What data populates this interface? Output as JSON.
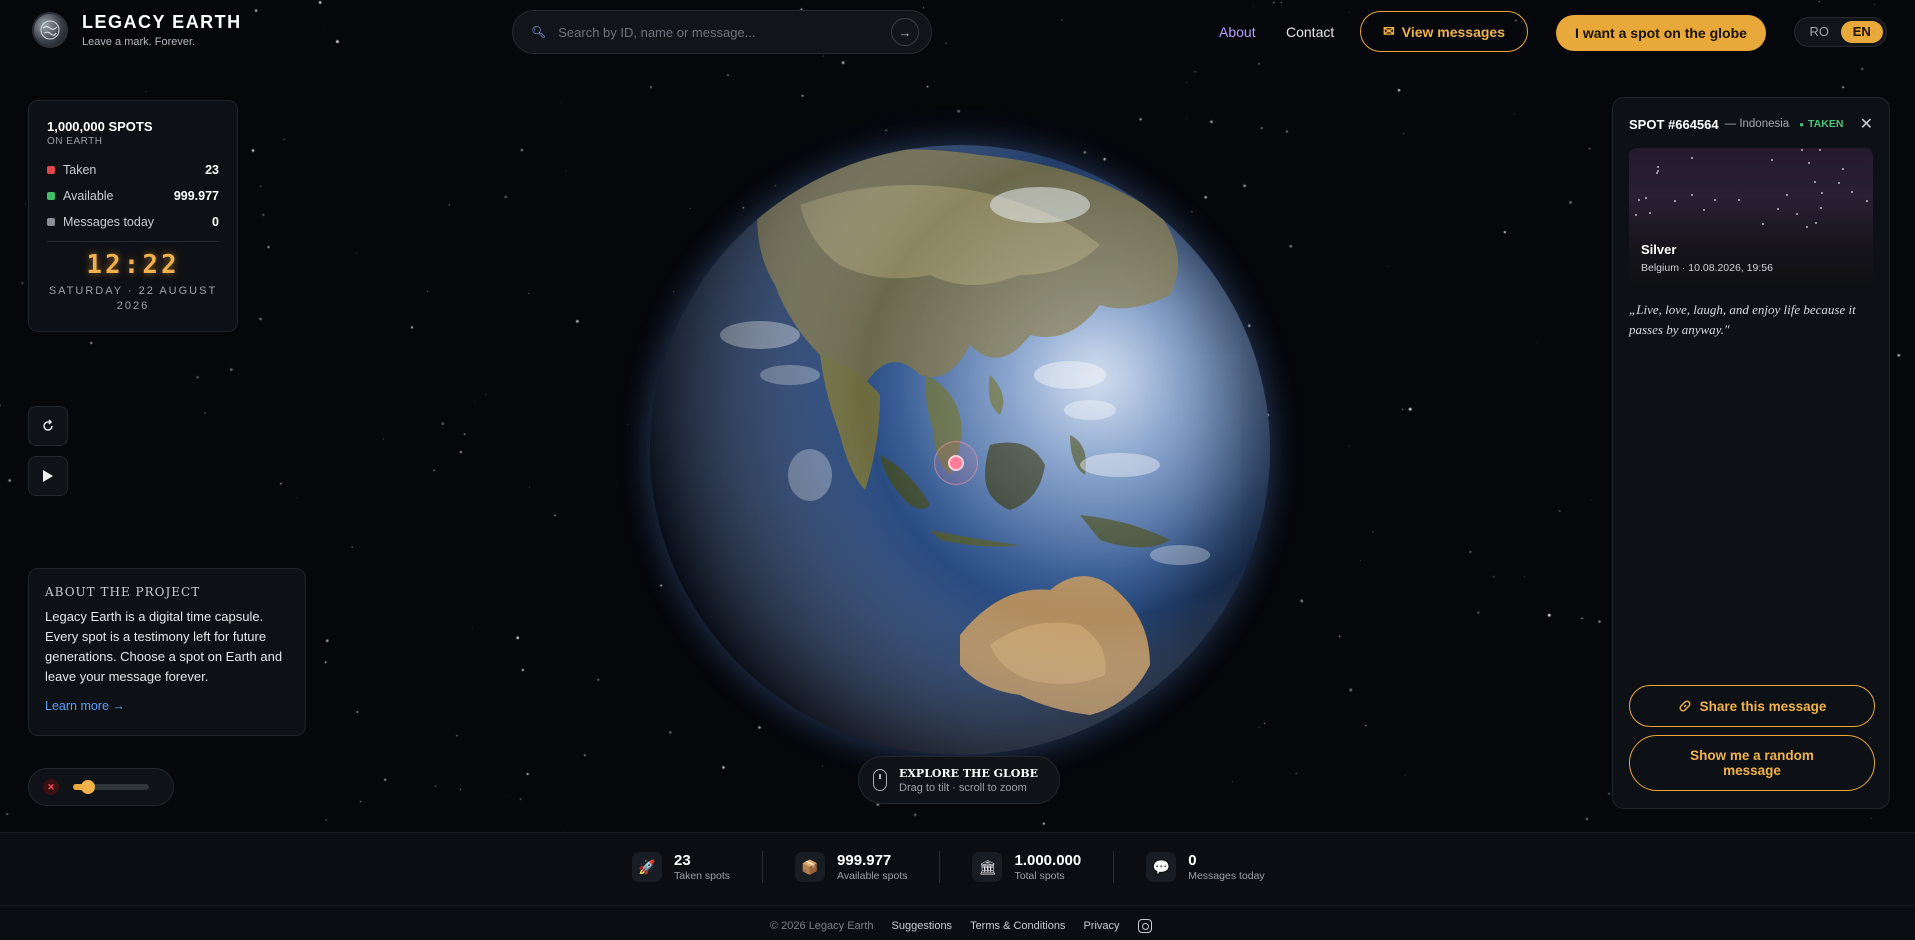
{
  "header": {
    "brand": "LEGACY EARTH",
    "tagline": "Leave a mark. Forever.",
    "search_placeholder": "Search by ID, name or message...",
    "nav_about": "About",
    "nav_contact": "Contact",
    "view_messages": "View messages",
    "want_spot": "I want a spot on the globe",
    "lang_ro": "RO",
    "lang_en": "EN"
  },
  "stats": {
    "title": "1,000,000 SPOTS",
    "subtitle": "ON EARTH",
    "rows": [
      {
        "label": "Taken",
        "value": "23",
        "color": "#e0474c"
      },
      {
        "label": "Available",
        "value": "999.977",
        "color": "#3fbf6b"
      },
      {
        "label": "Messages today",
        "value": "0",
        "color": "#8a8f97"
      }
    ],
    "clock": "12:22",
    "date_line1": "SATURDAY · 22 AUGUST",
    "date_line2": "2026"
  },
  "about": {
    "heading": "ABOUT THE PROJECT",
    "text": "Legacy Earth is a digital time capsule. Every spot is a testimony left for future generations. Choose a spot on Earth and leave your message forever.",
    "link": "Learn more →"
  },
  "volume": {
    "level": 0.2
  },
  "explore": {
    "title": "EXPLORE THE GLOBE",
    "subtitle": "Drag to tilt · scroll to zoom"
  },
  "spot": {
    "id": "SPOT #664564",
    "country": "— Indonesia",
    "status": "TAKEN",
    "name": "Silver",
    "meta": "Belgium · 10.08.2026, 19:56",
    "message": "„Live, love, laugh, and enjoy life because it passes by anyway.\"",
    "share": "Share this message",
    "random": "Show me a random message"
  },
  "footer": {
    "stats": [
      {
        "value": "23",
        "label": "Taken spots",
        "icon": "rocket-icon"
      },
      {
        "value": "999.977",
        "label": "Available spots",
        "icon": "box-icon"
      },
      {
        "value": "1.000.000",
        "label": "Total spots",
        "icon": "bank-icon"
      },
      {
        "value": "0",
        "label": "Messages today",
        "icon": "chat-icon"
      }
    ],
    "copyright": "© 2026 Legacy Earth",
    "links": [
      "Suggestions",
      "Terms & Conditions",
      "Privacy"
    ]
  }
}
